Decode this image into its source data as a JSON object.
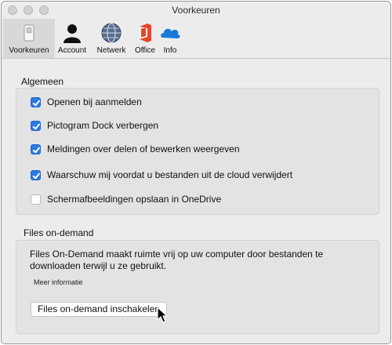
{
  "window": {
    "title": "Voorkeuren"
  },
  "toolbar": {
    "items": [
      {
        "label": "Voorkeuren",
        "icon": "switch-icon",
        "selected": true
      },
      {
        "label": "Account",
        "icon": "person-icon"
      },
      {
        "label": "Netwerk",
        "icon": "globe-icon"
      },
      {
        "label": "Office",
        "icon": "office-icon"
      },
      {
        "label": "Info",
        "icon": "cloud-icon"
      }
    ]
  },
  "general": {
    "title": "Algemeen",
    "options": [
      {
        "label": "Openen bij aanmelden",
        "checked": true
      },
      {
        "label": "Pictogram Dock verbergen",
        "checked": true
      },
      {
        "label": "Meldingen over delen of bewerken weergeven",
        "checked": true
      },
      {
        "label": "Waarschuw mij voordat u bestanden uit de cloud verwijdert",
        "checked": true
      },
      {
        "label": "Schermafbeeldingen opslaan in OneDrive",
        "checked": false
      }
    ]
  },
  "files_on_demand": {
    "title": "Files on-demand",
    "description": "Files On-Demand maakt ruimte vrij op uw computer door bestanden te downloaden terwijl u ze gebruikt.",
    "more_info": "Meer informatie",
    "button_label": "Files on-demand inschakelen"
  },
  "colors": {
    "accent": "#2b7ae6",
    "office": "#e8462a",
    "cloud": "#1a79d8"
  }
}
